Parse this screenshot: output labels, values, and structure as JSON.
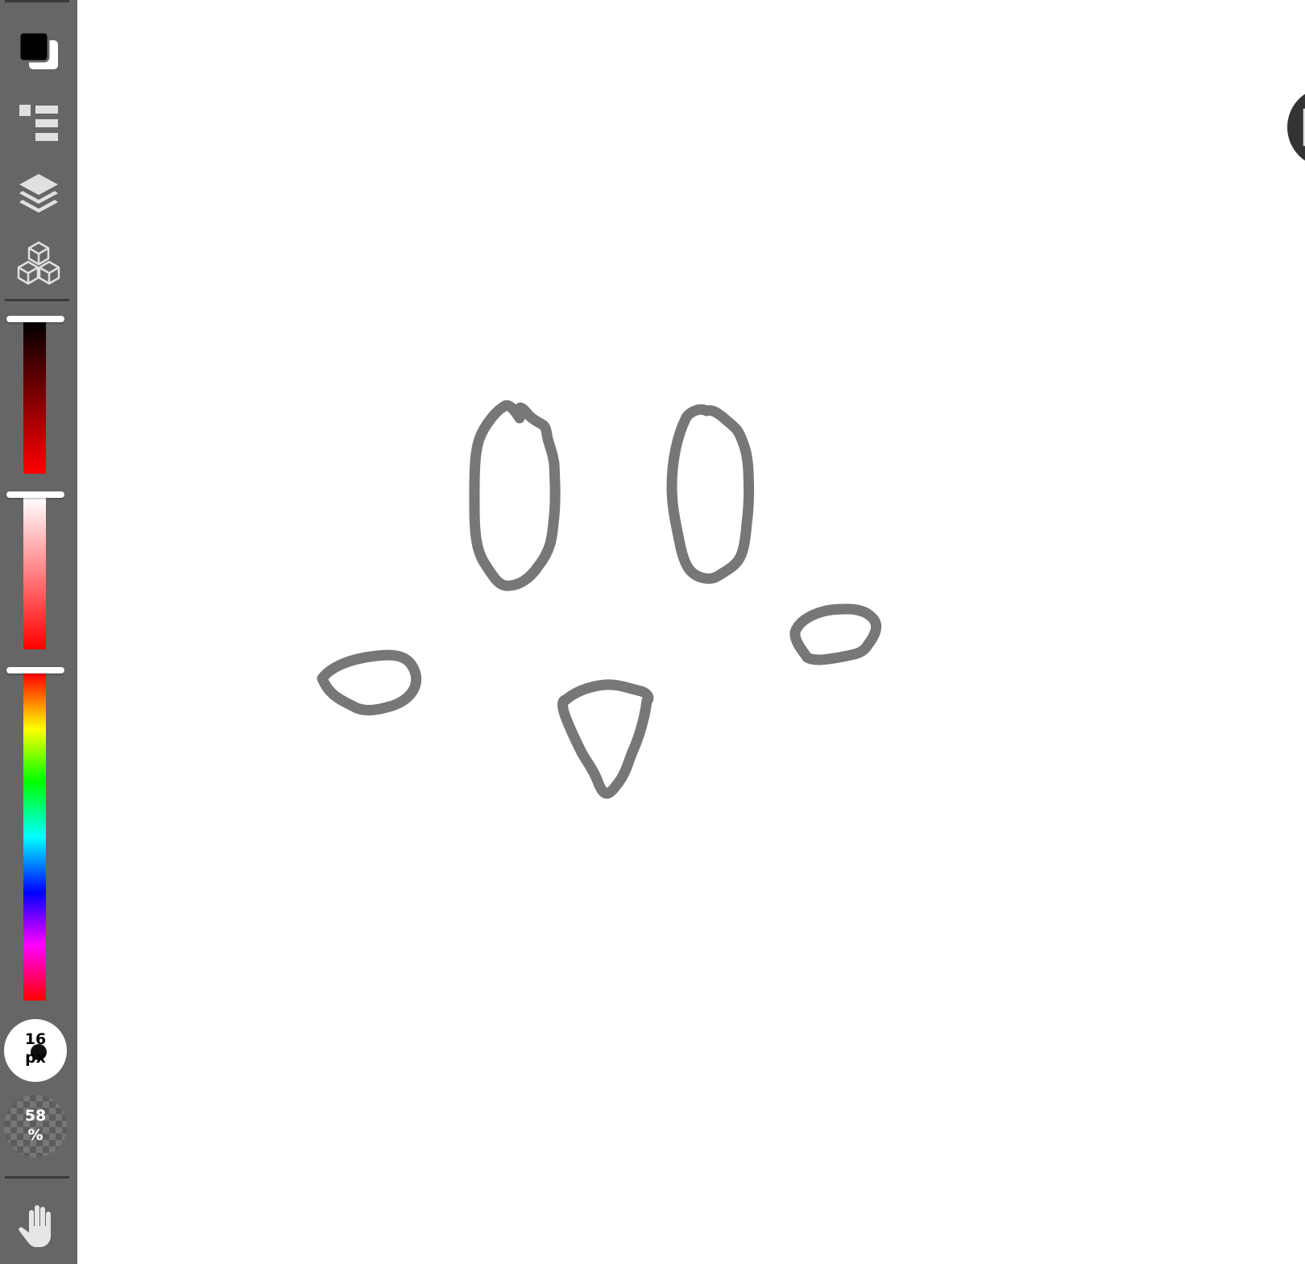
{
  "toolbar": {
    "colors": {
      "primary": "#000000",
      "secondary": "#ffffff",
      "sidebar_bg": "#666666",
      "stroke": "#777777"
    },
    "tools": [
      {
        "name": "color-swatch",
        "icon": "color-swatch-icon"
      },
      {
        "name": "tool-list",
        "icon": "list-icon"
      },
      {
        "name": "layers",
        "icon": "layers-icon"
      },
      {
        "name": "objects",
        "icon": "cubes-icon"
      }
    ],
    "sliders": {
      "brightness": {
        "value": 0.0,
        "gradient": [
          "#000000",
          "#ff0000"
        ]
      },
      "saturation": {
        "value": 0.0,
        "gradient": [
          "#ffffff",
          "#ff0000"
        ]
      },
      "hue": {
        "value": 0.0
      }
    },
    "brush_size": {
      "value": "16",
      "unit": "px"
    },
    "opacity": {
      "value": "58",
      "unit": "%"
    },
    "hand_tool": {
      "icon": "hand-icon"
    }
  },
  "canvas": {
    "fullscreen_button": {
      "icon": "fullscreen-icon"
    }
  }
}
